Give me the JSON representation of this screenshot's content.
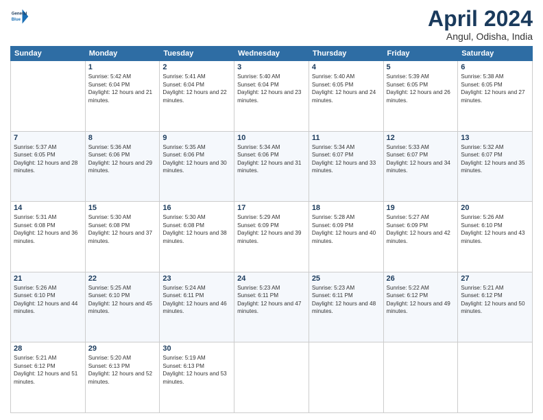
{
  "header": {
    "logo_line1": "General",
    "logo_line2": "Blue",
    "month": "April 2024",
    "location": "Angul, Odisha, India"
  },
  "days": [
    "Sunday",
    "Monday",
    "Tuesday",
    "Wednesday",
    "Thursday",
    "Friday",
    "Saturday"
  ],
  "weeks": [
    [
      {
        "num": "",
        "sunrise": "",
        "sunset": "",
        "daylight": ""
      },
      {
        "num": "1",
        "sunrise": "Sunrise: 5:42 AM",
        "sunset": "Sunset: 6:04 PM",
        "daylight": "Daylight: 12 hours and 21 minutes."
      },
      {
        "num": "2",
        "sunrise": "Sunrise: 5:41 AM",
        "sunset": "Sunset: 6:04 PM",
        "daylight": "Daylight: 12 hours and 22 minutes."
      },
      {
        "num": "3",
        "sunrise": "Sunrise: 5:40 AM",
        "sunset": "Sunset: 6:04 PM",
        "daylight": "Daylight: 12 hours and 23 minutes."
      },
      {
        "num": "4",
        "sunrise": "Sunrise: 5:40 AM",
        "sunset": "Sunset: 6:05 PM",
        "daylight": "Daylight: 12 hours and 24 minutes."
      },
      {
        "num": "5",
        "sunrise": "Sunrise: 5:39 AM",
        "sunset": "Sunset: 6:05 PM",
        "daylight": "Daylight: 12 hours and 26 minutes."
      },
      {
        "num": "6",
        "sunrise": "Sunrise: 5:38 AM",
        "sunset": "Sunset: 6:05 PM",
        "daylight": "Daylight: 12 hours and 27 minutes."
      }
    ],
    [
      {
        "num": "7",
        "sunrise": "Sunrise: 5:37 AM",
        "sunset": "Sunset: 6:05 PM",
        "daylight": "Daylight: 12 hours and 28 minutes."
      },
      {
        "num": "8",
        "sunrise": "Sunrise: 5:36 AM",
        "sunset": "Sunset: 6:06 PM",
        "daylight": "Daylight: 12 hours and 29 minutes."
      },
      {
        "num": "9",
        "sunrise": "Sunrise: 5:35 AM",
        "sunset": "Sunset: 6:06 PM",
        "daylight": "Daylight: 12 hours and 30 minutes."
      },
      {
        "num": "10",
        "sunrise": "Sunrise: 5:34 AM",
        "sunset": "Sunset: 6:06 PM",
        "daylight": "Daylight: 12 hours and 31 minutes."
      },
      {
        "num": "11",
        "sunrise": "Sunrise: 5:34 AM",
        "sunset": "Sunset: 6:07 PM",
        "daylight": "Daylight: 12 hours and 33 minutes."
      },
      {
        "num": "12",
        "sunrise": "Sunrise: 5:33 AM",
        "sunset": "Sunset: 6:07 PM",
        "daylight": "Daylight: 12 hours and 34 minutes."
      },
      {
        "num": "13",
        "sunrise": "Sunrise: 5:32 AM",
        "sunset": "Sunset: 6:07 PM",
        "daylight": "Daylight: 12 hours and 35 minutes."
      }
    ],
    [
      {
        "num": "14",
        "sunrise": "Sunrise: 5:31 AM",
        "sunset": "Sunset: 6:08 PM",
        "daylight": "Daylight: 12 hours and 36 minutes."
      },
      {
        "num": "15",
        "sunrise": "Sunrise: 5:30 AM",
        "sunset": "Sunset: 6:08 PM",
        "daylight": "Daylight: 12 hours and 37 minutes."
      },
      {
        "num": "16",
        "sunrise": "Sunrise: 5:30 AM",
        "sunset": "Sunset: 6:08 PM",
        "daylight": "Daylight: 12 hours and 38 minutes."
      },
      {
        "num": "17",
        "sunrise": "Sunrise: 5:29 AM",
        "sunset": "Sunset: 6:09 PM",
        "daylight": "Daylight: 12 hours and 39 minutes."
      },
      {
        "num": "18",
        "sunrise": "Sunrise: 5:28 AM",
        "sunset": "Sunset: 6:09 PM",
        "daylight": "Daylight: 12 hours and 40 minutes."
      },
      {
        "num": "19",
        "sunrise": "Sunrise: 5:27 AM",
        "sunset": "Sunset: 6:09 PM",
        "daylight": "Daylight: 12 hours and 42 minutes."
      },
      {
        "num": "20",
        "sunrise": "Sunrise: 5:26 AM",
        "sunset": "Sunset: 6:10 PM",
        "daylight": "Daylight: 12 hours and 43 minutes."
      }
    ],
    [
      {
        "num": "21",
        "sunrise": "Sunrise: 5:26 AM",
        "sunset": "Sunset: 6:10 PM",
        "daylight": "Daylight: 12 hours and 44 minutes."
      },
      {
        "num": "22",
        "sunrise": "Sunrise: 5:25 AM",
        "sunset": "Sunset: 6:10 PM",
        "daylight": "Daylight: 12 hours and 45 minutes."
      },
      {
        "num": "23",
        "sunrise": "Sunrise: 5:24 AM",
        "sunset": "Sunset: 6:11 PM",
        "daylight": "Daylight: 12 hours and 46 minutes."
      },
      {
        "num": "24",
        "sunrise": "Sunrise: 5:23 AM",
        "sunset": "Sunset: 6:11 PM",
        "daylight": "Daylight: 12 hours and 47 minutes."
      },
      {
        "num": "25",
        "sunrise": "Sunrise: 5:23 AM",
        "sunset": "Sunset: 6:11 PM",
        "daylight": "Daylight: 12 hours and 48 minutes."
      },
      {
        "num": "26",
        "sunrise": "Sunrise: 5:22 AM",
        "sunset": "Sunset: 6:12 PM",
        "daylight": "Daylight: 12 hours and 49 minutes."
      },
      {
        "num": "27",
        "sunrise": "Sunrise: 5:21 AM",
        "sunset": "Sunset: 6:12 PM",
        "daylight": "Daylight: 12 hours and 50 minutes."
      }
    ],
    [
      {
        "num": "28",
        "sunrise": "Sunrise: 5:21 AM",
        "sunset": "Sunset: 6:12 PM",
        "daylight": "Daylight: 12 hours and 51 minutes."
      },
      {
        "num": "29",
        "sunrise": "Sunrise: 5:20 AM",
        "sunset": "Sunset: 6:13 PM",
        "daylight": "Daylight: 12 hours and 52 minutes."
      },
      {
        "num": "30",
        "sunrise": "Sunrise: 5:19 AM",
        "sunset": "Sunset: 6:13 PM",
        "daylight": "Daylight: 12 hours and 53 minutes."
      },
      {
        "num": "",
        "sunrise": "",
        "sunset": "",
        "daylight": ""
      },
      {
        "num": "",
        "sunrise": "",
        "sunset": "",
        "daylight": ""
      },
      {
        "num": "",
        "sunrise": "",
        "sunset": "",
        "daylight": ""
      },
      {
        "num": "",
        "sunrise": "",
        "sunset": "",
        "daylight": ""
      }
    ]
  ]
}
